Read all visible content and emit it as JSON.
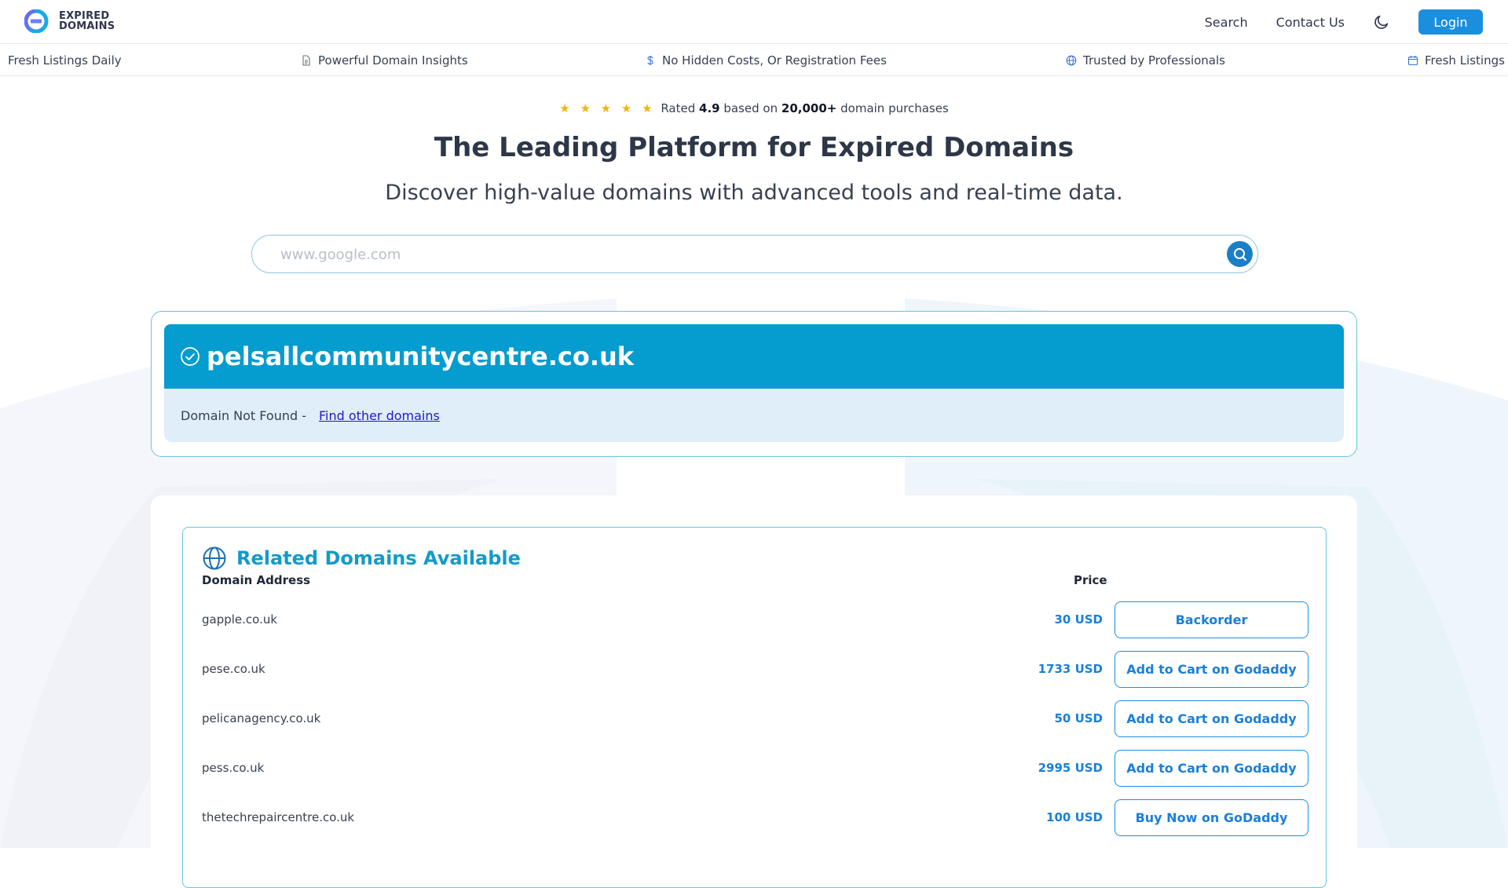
{
  "header": {
    "logo_line1": "EXPIRED",
    "logo_line2": "DOMAINS",
    "nav": {
      "search": "Search",
      "contact": "Contact Us",
      "login": "Login"
    }
  },
  "ticker": {
    "items": [
      {
        "label": "Fresh Listings Daily",
        "icon": "none"
      },
      {
        "label": "Powerful Domain Insights",
        "icon": "document-icon"
      },
      {
        "label": "No Hidden Costs, Or Registration Fees",
        "icon": "dollar-icon"
      },
      {
        "label": "Trusted by Professionals",
        "icon": "globe-icon"
      },
      {
        "label": "Fresh Listings",
        "icon": "calendar-icon"
      }
    ]
  },
  "hero": {
    "stars": "★ ★ ★ ★ ★",
    "rating_prefix": "Rated",
    "rating_value": "4.9",
    "rating_mid": "based on",
    "rating_count": "20,000+",
    "rating_suffix": "domain purchases",
    "headline": "The Leading Platform for Expired Domains",
    "subhead": "Discover high-value domains with advanced tools and real-time data.",
    "search_placeholder": "www.google.com"
  },
  "result": {
    "domain": "pelsallcommunitycentre.co.uk",
    "status": "Domain Not Found -",
    "link": "Find other domains"
  },
  "related": {
    "title": "Related Domains Available",
    "col_domain": "Domain Address",
    "col_price": "Price",
    "rows": [
      {
        "domain": "gapple.co.uk",
        "price": "30 USD",
        "action": "Backorder"
      },
      {
        "domain": "pese.co.uk",
        "price": "1733 USD",
        "action": "Add to Cart on Godaddy"
      },
      {
        "domain": "pelicanagency.co.uk",
        "price": "50 USD",
        "action": "Add to Cart on Godaddy"
      },
      {
        "domain": "pess.co.uk",
        "price": "2995 USD",
        "action": "Add to Cart on Godaddy"
      },
      {
        "domain": "thetechrepaircentre.co.uk",
        "price": "100 USD",
        "action": "Buy Now on GoDaddy"
      }
    ]
  },
  "colors": {
    "brand_blue": "#1a8fe0",
    "header_teal": "#059ccf",
    "star_gold": "#f5b40c"
  }
}
